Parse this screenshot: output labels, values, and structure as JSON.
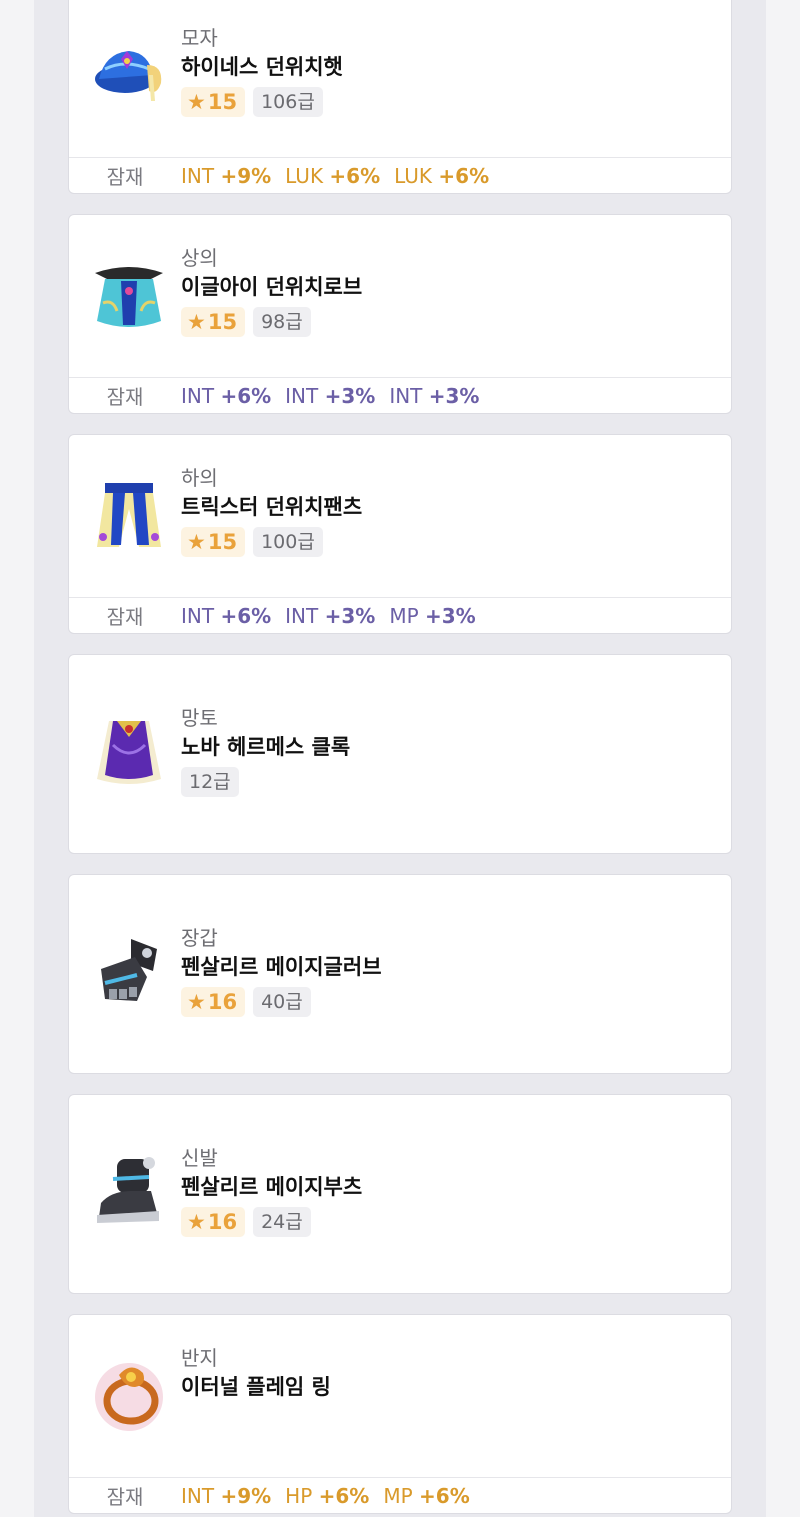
{
  "items": [
    {
      "slot": "모자",
      "name": "하이네스 던위치햇",
      "star": "15",
      "grade": "106급",
      "icon": "hat-icon",
      "potential": {
        "label": "잠재",
        "tier_color": "#d99a2b",
        "lines": [
          {
            "stat": "INT ",
            "value": "+9%"
          },
          {
            "stat": "LUK ",
            "value": "+6%"
          },
          {
            "stat": "LUK ",
            "value": "+6%"
          }
        ]
      }
    },
    {
      "slot": "상의",
      "name": "이글아이 던위치로브",
      "star": "15",
      "grade": "98급",
      "icon": "robe-icon",
      "potential": {
        "label": "잠재",
        "tier_color": "#6b5fa6",
        "lines": [
          {
            "stat": "INT ",
            "value": "+6%"
          },
          {
            "stat": "INT ",
            "value": "+3%"
          },
          {
            "stat": "INT ",
            "value": "+3%"
          }
        ]
      }
    },
    {
      "slot": "하의",
      "name": "트릭스터 던위치팬츠",
      "star": "15",
      "grade": "100급",
      "icon": "pants-icon",
      "potential": {
        "label": "잠재",
        "tier_color": "#6b5fa6",
        "lines": [
          {
            "stat": "INT ",
            "value": "+6%"
          },
          {
            "stat": "INT ",
            "value": "+3%"
          },
          {
            "stat": "MP ",
            "value": "+3%"
          }
        ]
      }
    },
    {
      "slot": "망토",
      "name": "노바 헤르메스 클록",
      "grade": "12급",
      "icon": "cape-icon"
    },
    {
      "slot": "장갑",
      "name": "펜살리르 메이지글러브",
      "star": "16",
      "grade": "40급",
      "icon": "glove-icon"
    },
    {
      "slot": "신발",
      "name": "펜살리르 메이지부츠",
      "star": "16",
      "grade": "24급",
      "icon": "boots-icon"
    },
    {
      "slot": "반지",
      "name": "이터널 플레임 링",
      "icon": "ring-icon",
      "potential": {
        "label": "잠재",
        "tier_color": "#d99a2b",
        "lines": [
          {
            "stat": "INT ",
            "value": "+9%"
          },
          {
            "stat": "HP ",
            "value": "+6%"
          },
          {
            "stat": "MP ",
            "value": "+6%"
          }
        ]
      }
    }
  ],
  "star_glyph": "★"
}
